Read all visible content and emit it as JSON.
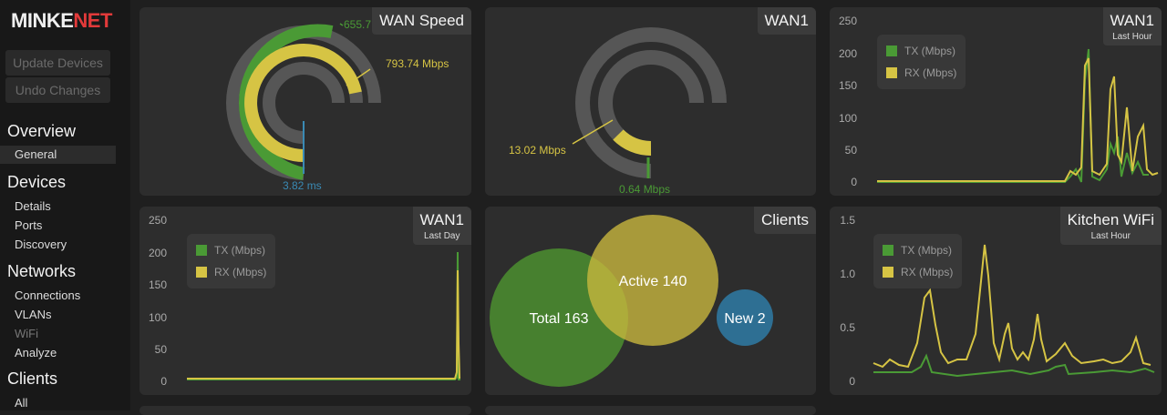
{
  "sidebar": {
    "logo_a": "MINKE",
    "logo_b": "NET",
    "update_button": "Update Devices",
    "undo_button": "Undo Changes",
    "sections": [
      {
        "label": "Overview",
        "items": [
          "General"
        ]
      },
      {
        "label": "Devices",
        "items": [
          "Details",
          "Ports",
          "Discovery"
        ]
      },
      {
        "label": "Networks",
        "items": [
          "Connections",
          "VLANs",
          "WiFi",
          "Analyze"
        ]
      },
      {
        "label": "Clients",
        "items": [
          "All"
        ]
      }
    ]
  },
  "colors": {
    "tx": "#4a9a35",
    "rx": "#d6c444",
    "latency": "#3a8ab4",
    "ring_bg": "#565656",
    "new_bubble": "#2e6f93"
  },
  "cards": {
    "wan_speed": {
      "title": "WAN Speed",
      "tx_label": "655.7",
      "rx_label": "793.74 Mbps",
      "latency_label": "3.82 ms",
      "tx_fraction": 0.82,
      "rx_fraction": 0.99
    },
    "wan1_gauge": {
      "title": "WAN1",
      "rx_label": "13.02 Mbps",
      "tx_label": "0.64 Mbps",
      "rx_fraction": 0.16,
      "tx_fraction": 0.01
    },
    "wan1_hour": {
      "title": "WAN1",
      "subtitle": "Last Hour",
      "legend": [
        "TX (Mbps)",
        "RX (Mbps)"
      ],
      "yticks": [
        "250",
        "200",
        "150",
        "100",
        "50",
        "0"
      ]
    },
    "wan1_day": {
      "title": "WAN1",
      "subtitle": "Last Day",
      "legend": [
        "TX (Mbps)",
        "RX (Mbps)"
      ],
      "yticks": [
        "250",
        "200",
        "150",
        "100",
        "50",
        "0"
      ]
    },
    "clients": {
      "title": "Clients",
      "total_label": "Total 163",
      "active_label": "Active 140",
      "new_label": "New 2",
      "total": 163,
      "active": 140,
      "new": 2
    },
    "kitchen_wifi": {
      "title": "Kitchen WiFi",
      "subtitle": "Last Hour",
      "legend": [
        "TX (Mbps)",
        "RX (Mbps)"
      ],
      "yticks": [
        "1.5",
        "1.0",
        "0.5",
        "0"
      ]
    }
  }
}
